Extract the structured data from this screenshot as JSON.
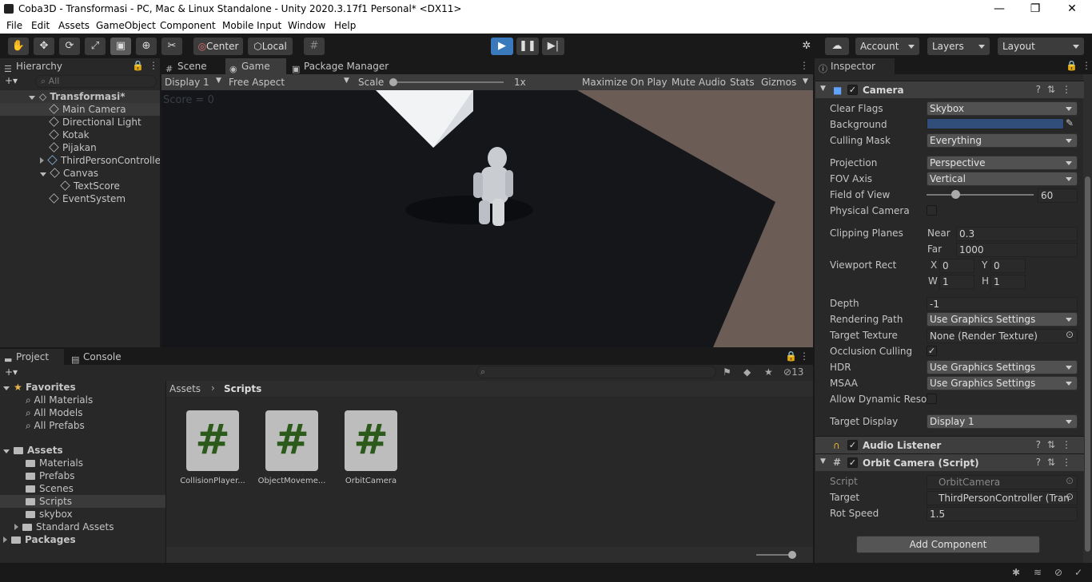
{
  "window": {
    "title": "Coba3D - Transformasi - PC, Mac & Linux Standalone - Unity 2020.3.17f1 Personal* <DX11>",
    "minimize": "—",
    "restore": "❐",
    "close": "✕"
  },
  "menu": [
    "File",
    "Edit",
    "Assets",
    "GameObject",
    "Component",
    "Mobile Input",
    "Window",
    "Help"
  ],
  "toolbar": {
    "pivot": "Center",
    "space": "Local",
    "account": "Account",
    "layers": "Layers",
    "layout": "Layout"
  },
  "hierarchy": {
    "tab": "Hierarchy",
    "search_placeholder": "All",
    "scene": "Transformasi*",
    "items": [
      "Main Camera",
      "Directional Light",
      "Kotak",
      "Pijakan",
      "ThirdPersonController",
      "Canvas",
      "TextScore",
      "EventSystem"
    ]
  },
  "game": {
    "tabs": [
      "Scene",
      "Game",
      "Package Manager"
    ],
    "display": "Display 1",
    "aspect": "Free Aspect",
    "scale_label": "Scale",
    "scale_value": "1x",
    "options": [
      "Maximize On Play",
      "Mute Audio",
      "Stats",
      "Gizmos"
    ],
    "overlay_text": "Score = 0"
  },
  "project": {
    "tabs": [
      "Project",
      "Console"
    ],
    "hidden_count": "13",
    "breadcrumb": [
      "Assets",
      "Scripts"
    ],
    "favorites": "Favorites",
    "fav_items": [
      "All Materials",
      "All Models",
      "All Prefabs"
    ],
    "assets_root": "Assets",
    "folders": [
      "Materials",
      "Prefabs",
      "Scenes",
      "Scripts",
      "skybox",
      "Standard Assets"
    ],
    "packages": "Packages",
    "files": [
      "CollisionPlayer...",
      "ObjectMoveme...",
      "OrbitCamera"
    ],
    "file_glyph": "#"
  },
  "inspector": {
    "tab": "Inspector",
    "camera": {
      "title": "Camera",
      "clear_flags_label": "Clear Flags",
      "clear_flags": "Skybox",
      "background_label": "Background",
      "background_color": "#314d79",
      "culling_mask_label": "Culling Mask",
      "culling_mask": "Everything",
      "projection_label": "Projection",
      "projection": "Perspective",
      "fov_axis_label": "FOV Axis",
      "fov_axis": "Vertical",
      "fov_label": "Field of View",
      "fov": "60",
      "fov_fraction": 0.27,
      "physical_label": "Physical Camera",
      "clipping_label": "Clipping Planes",
      "near_label": "Near",
      "near": "0.3",
      "far_label": "Far",
      "far": "1000",
      "viewport_label": "Viewport Rect",
      "vx_label": "X",
      "vx": "0",
      "vy_label": "Y",
      "vy": "0",
      "vw_label": "W",
      "vw": "1",
      "vh_label": "H",
      "vh": "1",
      "depth_label": "Depth",
      "depth": "-1",
      "rendering_path_label": "Rendering Path",
      "rendering_path": "Use Graphics Settings",
      "target_texture_label": "Target Texture",
      "target_texture": "None (Render Texture)",
      "occlusion_label": "Occlusion Culling",
      "hdr_label": "HDR",
      "hdr": "Use Graphics Settings",
      "msaa_label": "MSAA",
      "msaa": "Use Graphics Settings",
      "dyn_res_label": "Allow Dynamic Resol",
      "target_display_label": "Target Display",
      "target_display": "Display 1"
    },
    "audio_listener": {
      "title": "Audio Listener"
    },
    "orbit": {
      "title": "Orbit Camera (Script)",
      "script_label": "Script",
      "script": "OrbitCamera",
      "target_label": "Target",
      "target": "ThirdPersonController (Tran",
      "rot_speed_label": "Rot Speed",
      "rot_speed": "1.5"
    },
    "add_component": "Add Component"
  },
  "colors": {
    "accent_select": "#2c5d87",
    "play_button": "#3a79bb",
    "ground": "#14161a",
    "backdrop": "#6b5c55"
  }
}
